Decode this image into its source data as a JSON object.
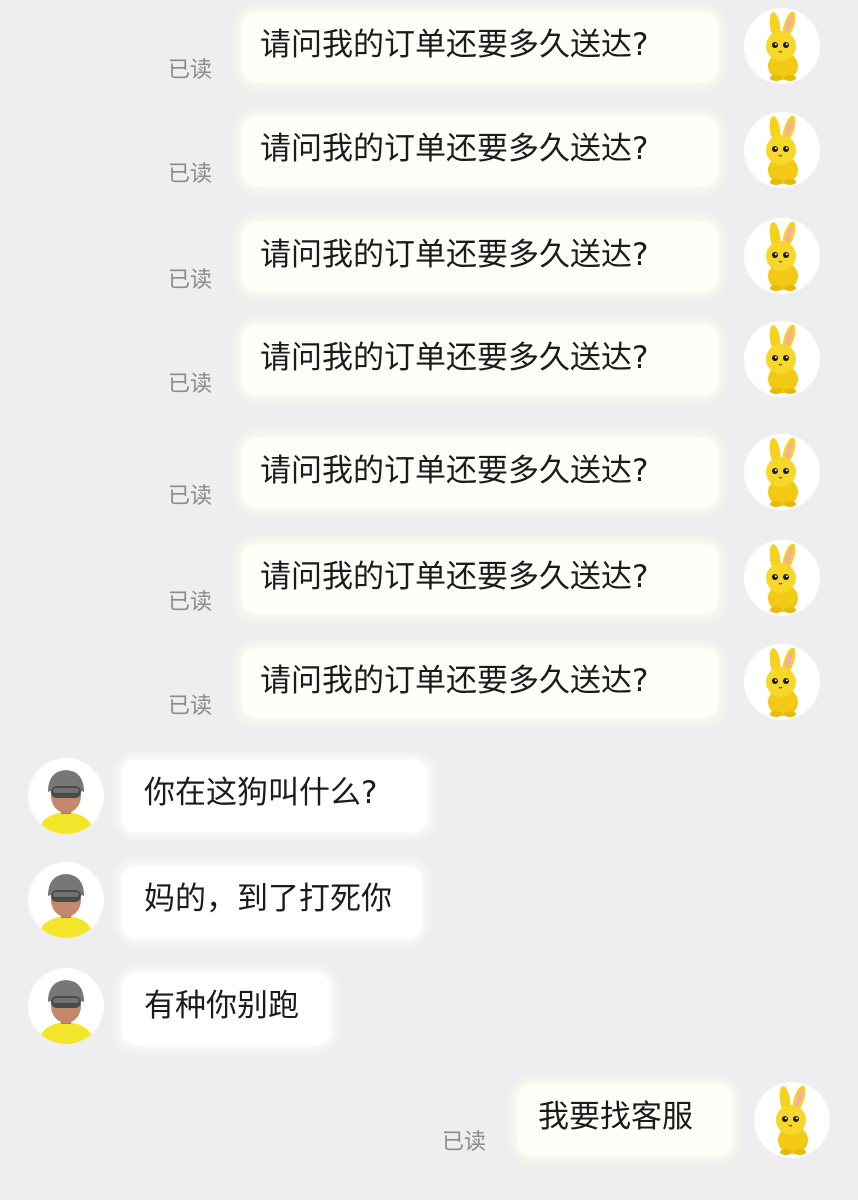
{
  "conversation": {
    "outgoing_messages": [
      {
        "text": "请问我的订单还要多久送达?",
        "status": "已读"
      },
      {
        "text": "请问我的订单还要多久送达?",
        "status": "已读"
      },
      {
        "text": "请问我的订单还要多久送达?",
        "status": "已读"
      },
      {
        "text": "请问我的订单还要多久送达?",
        "status": "已读"
      },
      {
        "text": "请问我的订单还要多久送达?",
        "status": "已读"
      },
      {
        "text": "请问我的订单还要多久送达?",
        "status": "已读"
      },
      {
        "text": "请问我的订单还要多久送达?",
        "status": "已读"
      }
    ],
    "incoming_messages": [
      {
        "text": "你在这狗叫什么?"
      },
      {
        "text": "妈的，到了打死你"
      },
      {
        "text": "有种你别跑"
      }
    ],
    "final_message": {
      "text": "我要找客服",
      "status": "已读"
    }
  },
  "avatars": {
    "self_icon": "yellow-bunny-icon",
    "courier_icon": "helmet-courier-icon"
  },
  "colors": {
    "background": "#eeeef0",
    "bubble": "#ffffff",
    "read_status": "#8a8a8a",
    "text": "#1b1b1b",
    "bunny": "#f5d21c",
    "courier_shirt": "#f3e52a"
  }
}
